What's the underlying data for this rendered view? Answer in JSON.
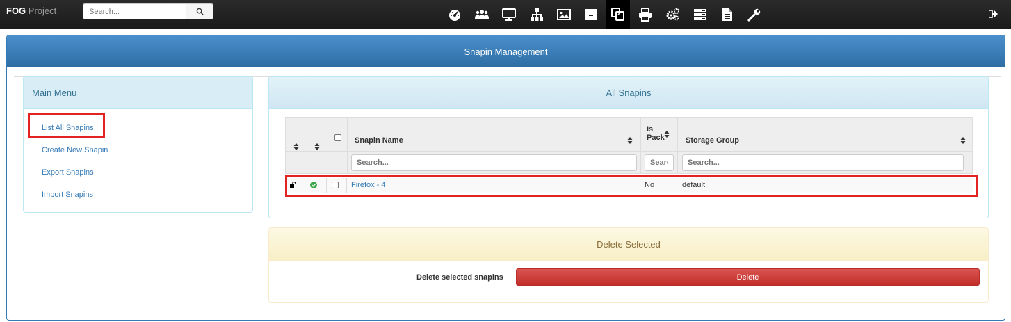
{
  "navbar": {
    "brand_bold": "FOG",
    "brand_rest": " Project",
    "search_placeholder": "Search...",
    "icons": [
      "dashboard-icon",
      "users-icon",
      "hosts-icon",
      "groups-icon",
      "images-icon",
      "storage-icon",
      "snapins-icon",
      "printers-icon",
      "services-icon",
      "tasks-icon",
      "reports-icon",
      "settings-icon"
    ],
    "active_icon": "snapins-icon"
  },
  "page": {
    "title": "Snapin Management"
  },
  "sidebar": {
    "heading": "Main Menu",
    "items": [
      {
        "label": "List All Snapins"
      },
      {
        "label": "Create New Snapin"
      },
      {
        "label": "Export Snapins"
      },
      {
        "label": "Import Snapins"
      }
    ]
  },
  "snapins": {
    "heading": "All Snapins",
    "columns": {
      "name": "Snapin Name",
      "is_pack_1": "Is",
      "is_pack_2": "Pack",
      "storage_group": "Storage Group"
    },
    "filters": {
      "name": "Search...",
      "is_pack": "Search...",
      "storage_group": "Search..."
    },
    "rows": [
      {
        "name": "Firefox - 4",
        "is_pack": "No",
        "storage_group": "default"
      }
    ]
  },
  "delete_panel": {
    "heading": "Delete Selected",
    "label": "Delete selected snapins",
    "button": "Delete"
  },
  "colors": {
    "primary": "#337ab7",
    "danger": "#d9534f",
    "highlight": "#e32222",
    "success": "#3ca84a"
  }
}
